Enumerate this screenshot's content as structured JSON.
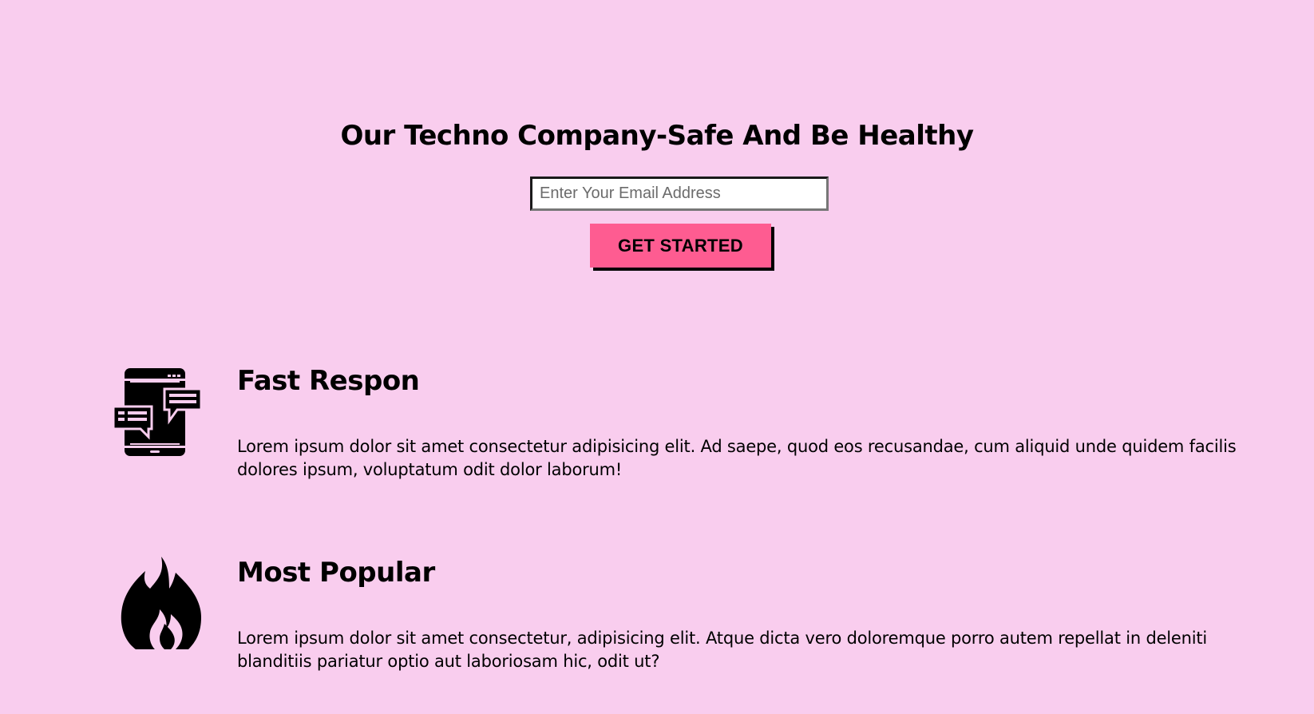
{
  "hero": {
    "title": "Our Techno Company-Safe And Be Healthy",
    "email_placeholder": "Enter Your Email Address",
    "cta_label": "GET STARTED"
  },
  "features": [
    {
      "icon": "mobile-chat-icon",
      "title": "Fast Respon",
      "text": "Lorem ipsum dolor sit amet consectetur adipisicing elit. Ad saepe, quod eos recusandae, cum aliquid unde quidem facilis dolores ipsum, voluptatum odit dolor laborum!"
    },
    {
      "icon": "fire-icon",
      "title": "Most Popular",
      "text": "Lorem ipsum dolor sit amet consectetur, adipisicing elit. Atque dicta vero doloremque porro autem repellat in deleniti blanditiis pariatur optio aut laboriosam hic, odit ut?"
    }
  ],
  "colors": {
    "background": "#f9cdee",
    "accent": "#fe5c91",
    "text": "#000000"
  }
}
